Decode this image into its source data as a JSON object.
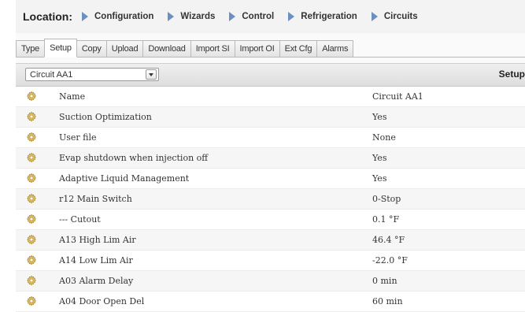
{
  "breadcrumb": {
    "label": "Location:",
    "items": [
      "Configuration",
      "Wizards",
      "Control",
      "Refrigeration",
      "Circuits"
    ]
  },
  "tabs": [
    {
      "label": "Type"
    },
    {
      "label": "Setup",
      "active": true
    },
    {
      "label": "Copy"
    },
    {
      "label": "Upload"
    },
    {
      "label": "Download"
    },
    {
      "label": "Import SI"
    },
    {
      "label": "Import OI"
    },
    {
      "label": "Ext Cfg"
    },
    {
      "label": "Alarms"
    }
  ],
  "toolbar": {
    "selected_circuit": "Circuit AA1",
    "section_title": "Setup"
  },
  "rows": [
    {
      "name": "Name",
      "value": "Circuit AA1",
      "icon": "gear-icon"
    },
    {
      "name": "Suction Optimization",
      "value": "Yes",
      "icon": "gear-icon"
    },
    {
      "name": "User file",
      "value": "None",
      "icon": "gear-icon"
    },
    {
      "name": "Evap shutdown when injection off",
      "value": "Yes",
      "icon": "gear-icon"
    },
    {
      "name": "Adaptive Liquid Management",
      "value": "Yes",
      "icon": "gear-icon"
    },
    {
      "name": "r12 Main Switch",
      "value": "0-Stop",
      "icon": "gear-icon"
    },
    {
      "name": "--- Cutout",
      "value": "0.1 °F",
      "icon": "gear-icon"
    },
    {
      "name": "A13 High Lim Air",
      "value": "46.4 °F",
      "icon": "gear-icon"
    },
    {
      "name": "A14 Low Lim Air",
      "value": "-22.0 °F",
      "icon": "gear-icon"
    },
    {
      "name": "A03 Alarm Delay",
      "value": "0 min",
      "icon": "gear-icon"
    },
    {
      "name": "A04 Door Open Del",
      "value": "60 min",
      "icon": "gear-icon"
    }
  ],
  "colors": {
    "breadcrumb_arrow": "#6c8fc0",
    "gear": "#d9b75a"
  }
}
